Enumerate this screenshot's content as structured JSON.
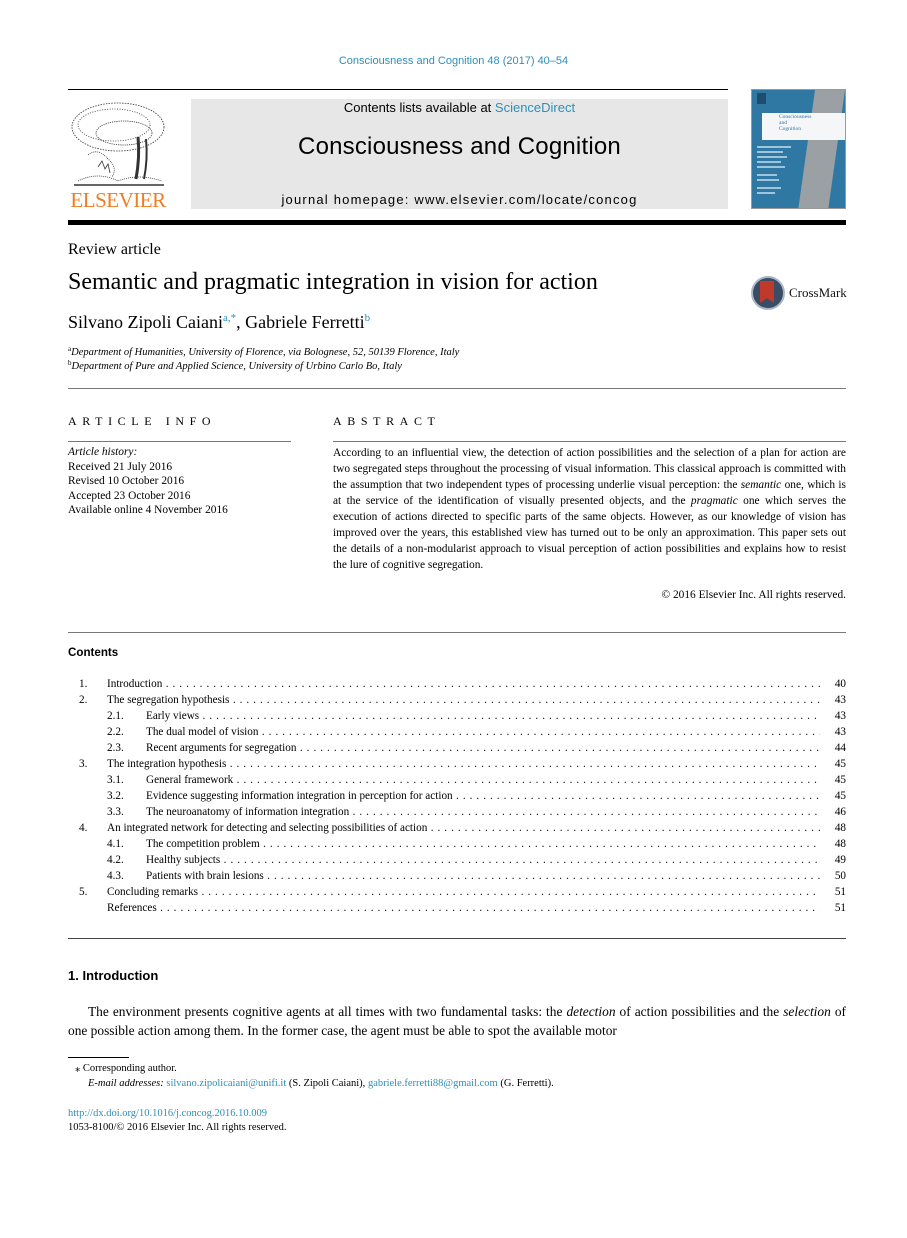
{
  "header": {
    "journal_reference": "Consciousness and Cognition 48 (2017) 40–54",
    "publisher_logo_text": "ELSEVIER",
    "contents_prefix": "Contents lists available at ",
    "contents_link": "ScienceDirect",
    "journal_name": "Consciousness and Cognition",
    "homepage_line": "journal homepage: www.elsevier.com/locate/concog",
    "cover": {
      "title_line1": "Consciousness",
      "title_line2": "and",
      "title_line3": "Cognition"
    }
  },
  "article": {
    "type": "Review article",
    "title": "Semantic and pragmatic integration in vision for action",
    "crossmark_label": "CrossMark",
    "authors": [
      {
        "name": "Silvano Zipoli Caiani",
        "sup": "a,*"
      },
      {
        "name": "Gabriele Ferretti",
        "sup": "b"
      }
    ],
    "author_separator": ", ",
    "affiliations": [
      {
        "sup": "a",
        "text": "Department of Humanities, University of Florence, via Bolognese, 52, 50139 Florence, Italy"
      },
      {
        "sup": "b",
        "text": "Department of Pure and Applied Science, University of Urbino Carlo Bo, Italy"
      }
    ]
  },
  "article_info": {
    "heading": "ARTICLE INFO",
    "history_label": "Article history:",
    "history": [
      "Received 21 July 2016",
      "Revised 10 October 2016",
      "Accepted 23 October 2016",
      "Available online 4 November 2016"
    ]
  },
  "abstract": {
    "heading": "ABSTRACT",
    "part1": "According to an influential view, the detection of action possibilities and the selection of a plan for action are two segregated steps throughout the processing of visual information. This classical approach is committed with the assumption that two independent types of processing underlie visual perception: the ",
    "em1": "semantic",
    "part2": " one, which is at the service of the identification of visually presented objects, and the ",
    "em2": "pragmatic",
    "part3": " one which serves the execution of actions directed to specific parts of the same objects. However, as our knowledge of vision has improved over the years, this established view has turned out to be only an approximation. This paper sets out the details of a non-modularist approach to visual perception of action possibilities and explains how to resist the lure of cognitive segregation.",
    "copyright": "© 2016 Elsevier Inc. All rights reserved."
  },
  "contents": {
    "heading": "Contents",
    "items": [
      {
        "num": "1.",
        "title": "Introduction",
        "page": "40",
        "level": 1
      },
      {
        "num": "2.",
        "title": "The segregation hypothesis",
        "page": "43",
        "level": 1
      },
      {
        "num": "2.1.",
        "title": "Early views",
        "page": "43",
        "level": 2
      },
      {
        "num": "2.2.",
        "title": "The dual model of vision",
        "page": "43",
        "level": 2
      },
      {
        "num": "2.3.",
        "title": "Recent arguments for segregation",
        "page": "44",
        "level": 2
      },
      {
        "num": "3.",
        "title": "The integration hypothesis",
        "page": "45",
        "level": 1
      },
      {
        "num": "3.1.",
        "title": "General framework",
        "page": "45",
        "level": 2
      },
      {
        "num": "3.2.",
        "title": "Evidence suggesting information integration in perception for action",
        "page": "45",
        "level": 2
      },
      {
        "num": "3.3.",
        "title": "The neuroanatomy of information integration",
        "page": "46",
        "level": 2
      },
      {
        "num": "4.",
        "title": "An integrated network for detecting and selecting possibilities of action",
        "page": "48",
        "level": 1
      },
      {
        "num": "4.1.",
        "title": "The competition problem",
        "page": "48",
        "level": 2
      },
      {
        "num": "4.2.",
        "title": "Healthy subjects",
        "page": "49",
        "level": 2
      },
      {
        "num": "4.3.",
        "title": "Patients with brain lesions",
        "page": "50",
        "level": 2
      },
      {
        "num": "5.",
        "title": "Concluding remarks",
        "page": "51",
        "level": 1
      },
      {
        "num": "",
        "title": "References",
        "page": "51",
        "level": 1
      }
    ]
  },
  "introduction": {
    "heading": "1. Introduction",
    "p1_a": "The environment presents cognitive agents at all times with two fundamental tasks: the ",
    "p1_em1": "detection",
    "p1_b": " of action possibilities and the ",
    "p1_em2": "selection",
    "p1_c": " of one possible action among them. In the former case, the agent must be able to spot the available motor"
  },
  "footnotes": {
    "corresponding_marker": "⁎",
    "corresponding": "Corresponding author.",
    "email_label": "E-mail addresses:",
    "email1": "silvano.zipolicaiani@unifi.it",
    "email1_owner": " (S. Zipoli Caiani), ",
    "email2": "gabriele.ferretti88@gmail.com",
    "email2_owner": " (G. Ferretti).",
    "doi": "http://dx.doi.org/10.1016/j.concog.2016.10.009",
    "issn": "1053-8100/© 2016 Elsevier Inc. All rights reserved."
  },
  "colors": {
    "link": "#2e8fb8",
    "elsevier_orange": "#f07d1f",
    "masthead_bg": "#e7e7e7",
    "cover_blue": "#2f78a3"
  }
}
